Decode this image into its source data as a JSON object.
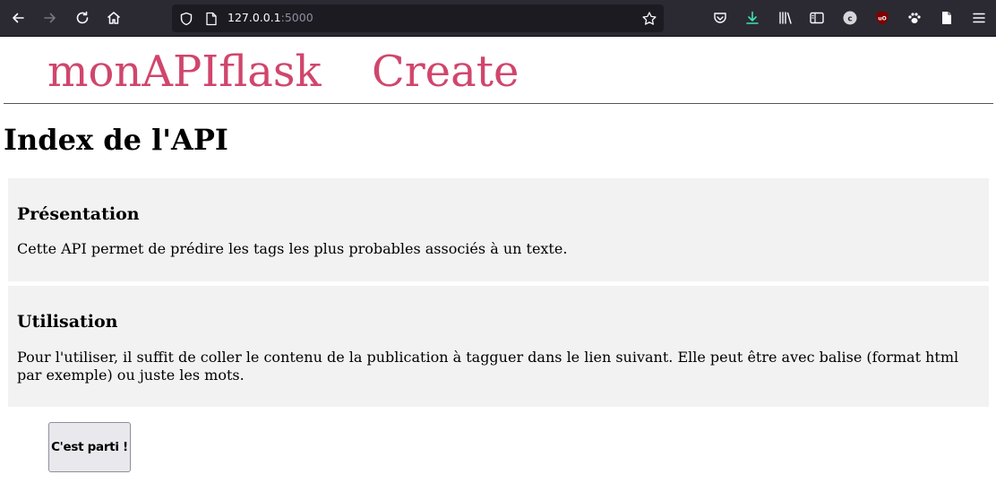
{
  "browser": {
    "url_host": "127.0.0.1",
    "url_port": ":5000",
    "icons": {
      "back": "back-arrow-icon",
      "forward": "forward-arrow-icon",
      "reload": "reload-icon",
      "home": "home-icon",
      "shield": "tracking-protection-shield-icon",
      "page": "page-info-icon",
      "bookmark": "bookmark-star-icon",
      "pocket": "pocket-icon",
      "downloads": "downloads-icon",
      "library": "library-icon",
      "sidebar": "sidebar-icon",
      "account": "account-c-icon",
      "ublock": "ublock-origin-icon",
      "extension": "paw-extension-icon",
      "reader": "document-icon",
      "menu": "hamburger-menu-icon"
    },
    "colors": {
      "toolbar": "#2b2a33",
      "urlbar": "#1c1b22",
      "download_accent": "#3fe1b0"
    }
  },
  "nav": {
    "brand": "monAPIflask",
    "create": "Create",
    "link_color": "#d0466c"
  },
  "main": {
    "title": "Index de l'API",
    "sections": [
      {
        "heading": "Présentation",
        "text": "Cette API permet de prédire les tags les plus probables associés à un texte."
      },
      {
        "heading": "Utilisation",
        "text": "Pour l'utiliser, il suffit de coller le contenu de la publication à tagguer dans le lien suivant. Elle peut être avec balise (format html par exemple) ou juste les mots."
      }
    ],
    "button": "C'est parti !"
  }
}
